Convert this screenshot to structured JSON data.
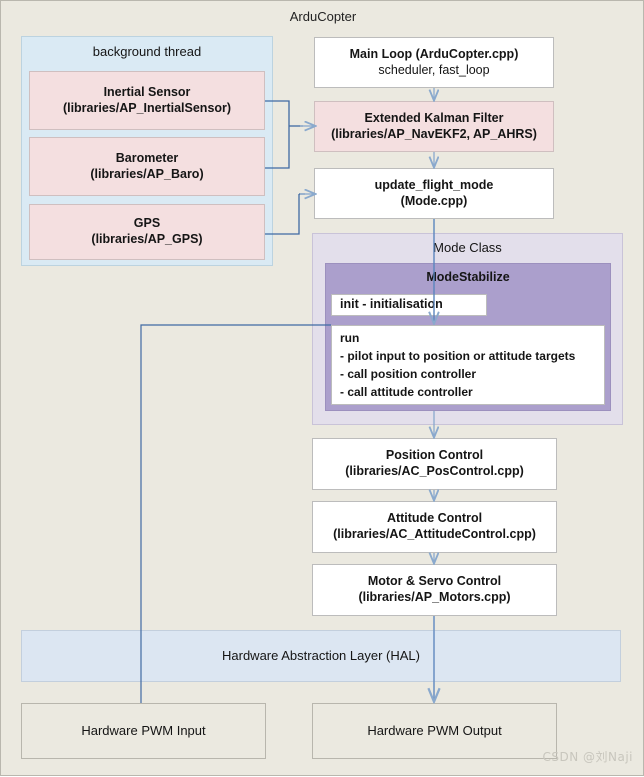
{
  "diagram": {
    "title": "ArduCopter",
    "watermark": "CSDN @刘Naji",
    "colors": {
      "background": "#ebe9e0",
      "white_box": "#ffffff",
      "sensor_pink": "#f4dfe0",
      "thread_blue": "#daeaf4",
      "hal_blue": "#dce6f2",
      "mode_class_lavender": "#e3dfeb",
      "mode_stabilize_purple": "#ab9fcc",
      "wire": "#3f6aa3",
      "arrow": "#8aa9cd"
    }
  },
  "background_thread": {
    "label": "background thread",
    "sensors": [
      {
        "title": "Inertial Sensor",
        "path": "(libraries/AP_InertialSensor)"
      },
      {
        "title": "Barometer",
        "path": "(libraries/AP_Baro)"
      },
      {
        "title": "GPS",
        "path": "(libraries/AP_GPS)"
      }
    ]
  },
  "pipeline": {
    "main_loop": {
      "title": "Main Loop (ArduCopter.cpp)",
      "sub": "scheduler, fast_loop"
    },
    "ekf": {
      "title": "Extended Kalman Filter",
      "path": "(libraries/AP_NavEKF2, AP_AHRS)"
    },
    "update_flight_mode": {
      "title": "update_flight_mode",
      "path": "(Mode.cpp)"
    },
    "position_control": {
      "title": "Position Control",
      "path": "(libraries/AC_PosControl.cpp)"
    },
    "attitude_control": {
      "title": "Attitude Control",
      "path": "(libraries/AC_AttitudeControl.cpp)"
    },
    "motor_servo_control": {
      "title": "Motor & Servo Control",
      "path": "(libraries/AP_Motors.cpp)"
    }
  },
  "mode_class": {
    "label": "Mode Class",
    "mode_stabilize": {
      "title": "ModeStabilize",
      "init": "init - initialisation",
      "run": {
        "header": "run",
        "steps": [
          "- pilot input to position or attitude targets",
          "- call position controller",
          "- call attitude controller"
        ]
      }
    }
  },
  "hal": {
    "label": "Hardware Abstraction Layer (HAL)"
  },
  "hardware": {
    "pwm_input": "Hardware PWM Input",
    "pwm_output": "Hardware PWM Output"
  }
}
